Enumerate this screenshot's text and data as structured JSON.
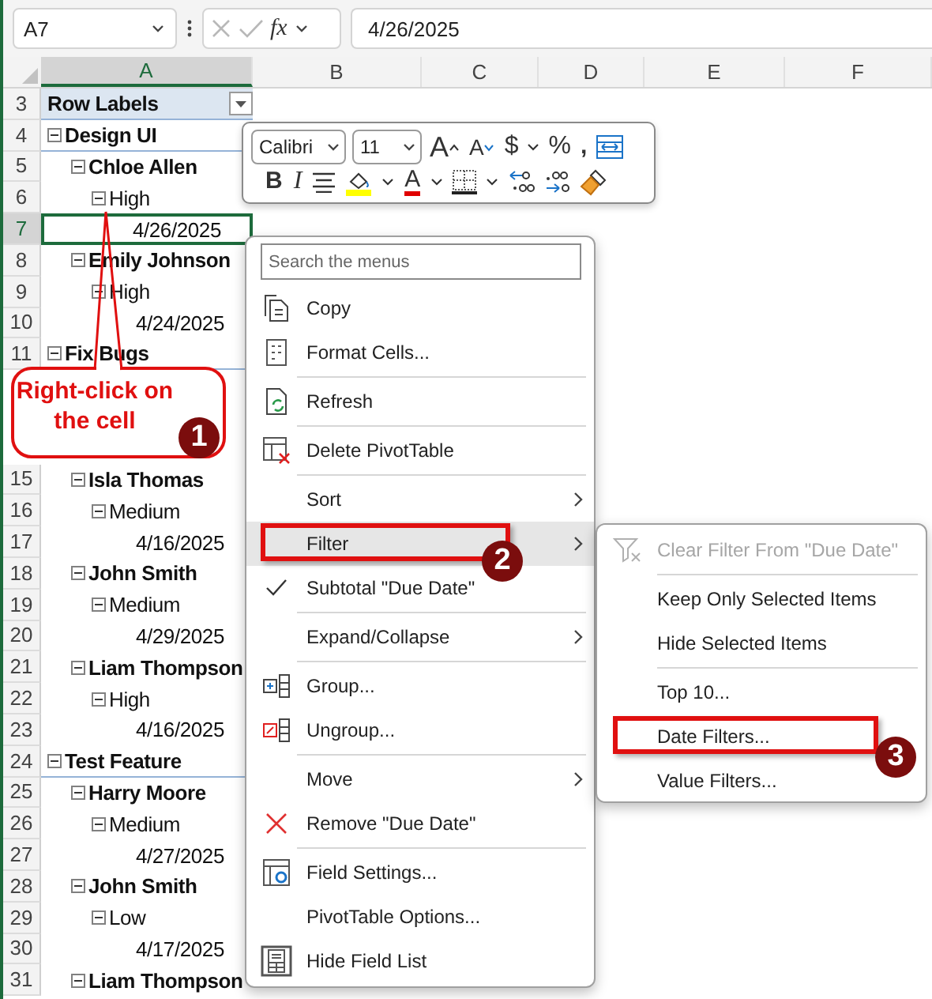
{
  "formula_bar": {
    "name_box": "A7",
    "function_label": "fx",
    "formula": "4/26/2025"
  },
  "columns": [
    {
      "label": "A",
      "selected": true
    },
    {
      "label": "B",
      "selected": false
    },
    {
      "label": "C",
      "selected": false
    },
    {
      "label": "D",
      "selected": false
    },
    {
      "label": "E",
      "selected": false
    },
    {
      "label": "F",
      "selected": false
    }
  ],
  "header_row": {
    "row": "3",
    "label": "Row Labels"
  },
  "pivot": [
    {
      "row": "4",
      "label": "Design UI",
      "expanded": true,
      "selected": false,
      "children": [
        {
          "row": "5",
          "label": "Chloe Allen",
          "expanded": true,
          "selected": false,
          "children": [
            {
              "row": "6",
              "label": "High",
              "expanded": true,
              "selected": false,
              "children": [
                {
                  "row": "7",
                  "label": "4/26/2025",
                  "selected": true
                }
              ]
            }
          ]
        },
        {
          "row": "8",
          "label": "Emily Johnson",
          "expanded": true,
          "selected": false,
          "children": [
            {
              "row": "9",
              "label": "High",
              "expanded": true,
              "selected": false,
              "children": [
                {
                  "row": "10",
                  "label": "4/24/2025",
                  "selected": false
                }
              ]
            }
          ]
        }
      ]
    },
    {
      "row": "11",
      "label": "Fix Bugs",
      "expanded": true,
      "selected": false,
      "children": [
        {
          "kind": "covered",
          "children": [
            {
              "kind": "covered",
              "children": [
                {
                  "kind": "covered"
                }
              ]
            }
          ]
        },
        {
          "row": "15",
          "label": "Isla Thomas",
          "expanded": true,
          "selected": false,
          "children": [
            {
              "row": "16",
              "label": "Medium",
              "expanded": true,
              "selected": false,
              "children": [
                {
                  "row": "17",
                  "label": "4/16/2025",
                  "selected": false
                }
              ]
            }
          ]
        },
        {
          "row": "18",
          "label": "John Smith",
          "expanded": true,
          "selected": false,
          "children": [
            {
              "row": "19",
              "label": "Medium",
              "expanded": true,
              "selected": false,
              "children": [
                {
                  "row": "20",
                  "label": "4/29/2025",
                  "selected": false
                }
              ]
            }
          ]
        },
        {
          "row": "21",
          "label": "Liam Thompson",
          "expanded": true,
          "selected": false,
          "children": [
            {
              "row": "22",
              "label": "High",
              "expanded": true,
              "selected": false,
              "children": [
                {
                  "row": "23",
                  "label": "4/16/2025",
                  "selected": false
                }
              ]
            }
          ]
        }
      ]
    },
    {
      "row": "24",
      "label": "Test Feature",
      "expanded": true,
      "selected": false,
      "children": [
        {
          "row": "25",
          "label": "Harry Moore",
          "expanded": true,
          "selected": false,
          "children": [
            {
              "row": "26",
              "label": "Medium",
              "expanded": true,
              "selected": false,
              "children": [
                {
                  "row": "27",
                  "label": "4/27/2025",
                  "selected": false
                }
              ]
            }
          ]
        },
        {
          "row": "28",
          "label": "John Smith",
          "expanded": true,
          "selected": false,
          "children": [
            {
              "row": "29",
              "label": "Low",
              "expanded": true,
              "selected": false,
              "children": [
                {
                  "row": "30",
                  "label": "4/17/2025",
                  "selected": false
                }
              ]
            }
          ]
        },
        {
          "row": "31",
          "label": "Liam Thompson",
          "expanded": true,
          "selected": false
        }
      ]
    }
  ],
  "mini_toolbar": {
    "top_row": [
      {
        "kind": "dropdown",
        "label": "Calibri"
      },
      {
        "kind": "dropdown",
        "label": "11"
      },
      {
        "kind": "grow",
        "label": "A"
      },
      {
        "kind": "shrink",
        "label": "A"
      },
      {
        "kind": "text",
        "label": "$"
      },
      {
        "kind": "caret"
      },
      {
        "kind": "text",
        "label": "%"
      },
      {
        "kind": "bold",
        "label": ","
      },
      {
        "kind": "wrap"
      }
    ],
    "bottom_row": [
      {
        "kind": "bold",
        "label": "B"
      },
      {
        "kind": "italic",
        "label": "I"
      },
      {
        "kind": "align"
      },
      {
        "kind": "fill-color"
      },
      {
        "kind": "caret"
      },
      {
        "kind": "font-color",
        "label": "A"
      },
      {
        "kind": "caret"
      },
      {
        "kind": "borders"
      },
      {
        "kind": "caret"
      },
      {
        "kind": "inc-decimal"
      },
      {
        "kind": "dec-decimal"
      },
      {
        "kind": "painter"
      }
    ]
  },
  "context_menu": {
    "search_placeholder": "Search the menus",
    "items": [
      {
        "kind": "copy",
        "label": "Copy",
        "submenu": false,
        "checked": false,
        "selected": false
      },
      {
        "kind": "format-cells",
        "label": "Format Cells...",
        "submenu": false,
        "checked": false,
        "selected": false
      },
      {
        "kind": "refresh",
        "label": "Refresh",
        "separator_before": true,
        "submenu": false,
        "checked": false,
        "selected": false
      },
      {
        "kind": "delete-table",
        "label": "Delete PivotTable",
        "separator_before": true,
        "submenu": false,
        "checked": false,
        "selected": false
      },
      {
        "kind": "plain",
        "label": "Sort",
        "separator_before": true,
        "submenu": true,
        "checked": false,
        "selected": false
      },
      {
        "kind": "plain",
        "label": "Filter",
        "submenu": true,
        "checked": false,
        "selected": true,
        "step": "2"
      },
      {
        "kind": "plain",
        "label": "Subtotal \"Due Date\"",
        "submenu": false,
        "checked": true,
        "selected": false
      },
      {
        "kind": "plain",
        "label": "Expand/Collapse",
        "separator_before": true,
        "submenu": true,
        "checked": false,
        "selected": false
      },
      {
        "kind": "group",
        "label": "Group...",
        "separator_before": true,
        "submenu": false,
        "checked": false,
        "selected": false
      },
      {
        "kind": "ungroup",
        "label": "Ungroup...",
        "submenu": false,
        "checked": false,
        "selected": false
      },
      {
        "kind": "plain",
        "label": "Move",
        "separator_before": true,
        "submenu": true,
        "checked": false,
        "selected": false
      },
      {
        "kind": "remove",
        "label": "Remove \"Due Date\"",
        "submenu": false,
        "checked": false,
        "selected": false
      },
      {
        "kind": "field-settings",
        "label": "Field Settings...",
        "separator_before": true,
        "submenu": false,
        "checked": false,
        "selected": false
      },
      {
        "kind": "plain",
        "label": "PivotTable Options...",
        "submenu": false,
        "checked": false,
        "selected": false
      },
      {
        "kind": "field-list",
        "label": "Hide Field List",
        "submenu": false,
        "checked": false,
        "selected": false
      }
    ]
  },
  "submenu": {
    "items": [
      {
        "kind": "clear-filter",
        "label": "Clear Filter From \"Due Date\"",
        "disabled": true
      },
      {
        "kind": "plain",
        "label": "Keep Only Selected Items",
        "separator_before": true,
        "disabled": false
      },
      {
        "kind": "plain",
        "label": "Hide Selected Items",
        "disabled": false
      },
      {
        "kind": "plain",
        "label": "Top 10...",
        "separator_before": true,
        "disabled": false
      },
      {
        "kind": "plain",
        "label": "Date Filters...",
        "disabled": false,
        "step": "3"
      },
      {
        "kind": "plain",
        "label": "Value Filters...",
        "disabled": false
      }
    ]
  },
  "callout": {
    "text": "Right-click on the cell",
    "step": "1"
  }
}
